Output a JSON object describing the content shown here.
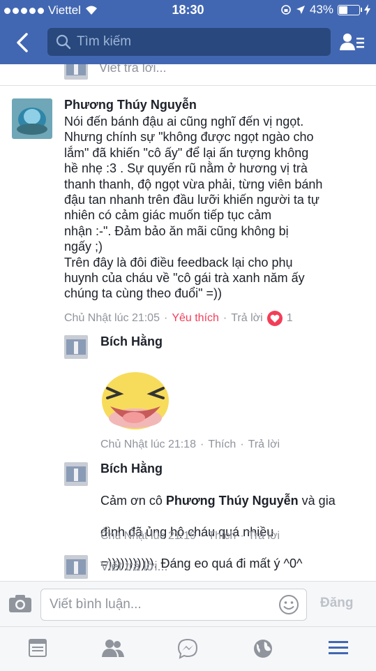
{
  "status_bar": {
    "carrier": "Viettel",
    "time": "18:30",
    "battery": "43%",
    "battery_level": 0.43
  },
  "search": {
    "placeholder": "Tìm kiếm"
  },
  "previous_reply": {
    "label": "Viết trả lời..."
  },
  "comment": {
    "author": "Phương Thúy Nguyễn",
    "lines": [
      "Nói đến bánh đậu ai cũng nghĩ đến vị ngọt.",
      "Nhưng chính sự \"không được ngọt ngào cho",
      "lắm\" đã khiến \"cô ấy\" để lại ấn tượng không",
      "hề nhẹ :3 . Sự quyến rũ nằm ở hương vị trà",
      "thanh thanh, độ ngọt vừa phải, từng viên bánh",
      "đậu tan nhanh trên đầu lưỡi khiến người ta tự",
      "nhiên có cảm giác muốn tiếp tục cảm",
      "nhận :-\". Đảm bảo ăn mãi cũng không bị",
      "ngấy ;)",
      "Trên đây là đôi điều feedback lại cho phụ",
      "huynh của cháu về \"cô gái trà xanh năm ấy",
      "chúng ta cùng theo đuổi\" =))"
    ],
    "time": "Chủ Nhật lúc 21:05",
    "like_label": "Yêu thích",
    "reply_label": "Trả lời",
    "reaction_count": "1",
    "sep": "·"
  },
  "replies": [
    {
      "author": "Bích Hằng",
      "time": "Chủ Nhật lúc 21:18",
      "like_label": "Thích",
      "reply_label": "Trả lời"
    },
    {
      "author": "Bích Hằng",
      "text_pre": "Cảm ơn cô ",
      "mention": "Phương Thúy Nguyễn",
      "text_post1": " và gia",
      "line2": "đình đã ủng hộ cháu quá nhiều",
      "line3": "=))))))))))). Đáng eo quá đi mất ý ^0^",
      "time": "Chủ Nhật lúc 21:19",
      "like_label": "Thích",
      "reply_label": "Trả lời"
    }
  ],
  "reply_box": {
    "placeholder": "Viết trả lời..."
  },
  "comment_bar": {
    "placeholder": "Viết bình luận...",
    "post_label": "Đăng"
  },
  "colors": {
    "brand": "#4267b2",
    "like": "#f33e58",
    "meta": "#90949c"
  },
  "tabs": [
    {
      "icon": "news-feed-icon"
    },
    {
      "icon": "friends-icon"
    },
    {
      "icon": "messenger-icon"
    },
    {
      "icon": "globe-icon"
    },
    {
      "icon": "menu-icon"
    }
  ]
}
